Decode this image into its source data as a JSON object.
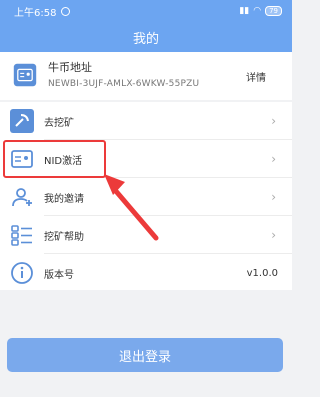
{
  "status": {
    "time": "上午6:58",
    "battery": "79"
  },
  "header": {
    "title": "我的"
  },
  "address": {
    "title": "牛币地址",
    "value": "NEWBI-3UJF-AMLX-6WKW-55PZU",
    "detail": "详情"
  },
  "menu": [
    {
      "label": "去挖矿"
    },
    {
      "label": "NID激活"
    },
    {
      "label": "我的邀请"
    },
    {
      "label": "挖矿帮助"
    },
    {
      "label": "版本号",
      "value": "v1.0.0"
    }
  ],
  "logout_label": "退出登录",
  "colors": {
    "primary": "#6ca5f1",
    "highlight": "#ec3a3a",
    "icon": "#5b8fd8"
  }
}
